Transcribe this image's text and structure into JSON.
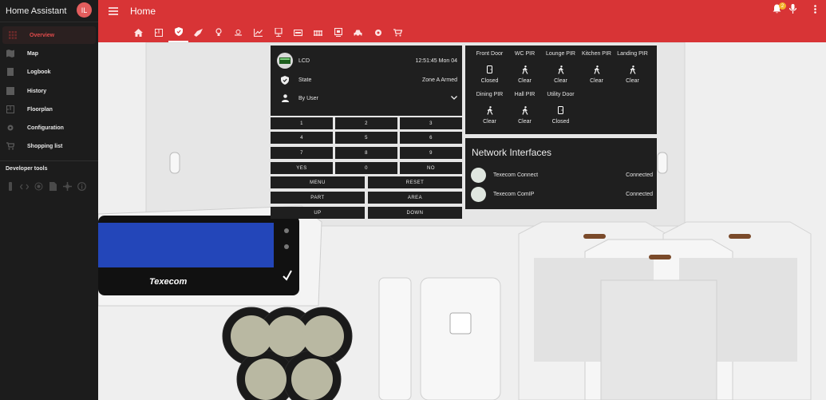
{
  "app": {
    "title": "Home Assistant",
    "avatar_initials": "IL"
  },
  "sidebar": {
    "items": [
      {
        "label": "Overview",
        "icon": "grid-icon",
        "active": true
      },
      {
        "label": "Map",
        "icon": "map-icon"
      },
      {
        "label": "Logbook",
        "icon": "logbook-icon"
      },
      {
        "label": "History",
        "icon": "history-icon"
      },
      {
        "label": "Floorplan",
        "icon": "floorplan-icon"
      },
      {
        "label": "Configuration",
        "icon": "gear-icon"
      },
      {
        "label": "Shopping list",
        "icon": "cart-icon"
      }
    ],
    "developer_tools_label": "Developer tools",
    "developer_icons": [
      "remote-icon",
      "code-icon",
      "antenna-icon",
      "file-icon",
      "network-icon",
      "info-icon"
    ]
  },
  "header": {
    "title": "Home",
    "tabs": [
      "home-icon",
      "floorplan-icon",
      "shield-icon",
      "rocket-icon",
      "bulb-icon",
      "weather-icon",
      "chart-icon",
      "monitor-icon",
      "tv-icon",
      "heater-icon",
      "media-icon",
      "car-icon",
      "gear-icon",
      "cart-icon"
    ],
    "notification_count": "2"
  },
  "alarm": {
    "lcd_label": "LCD",
    "lcd_value": "12:51:45 Mon 04",
    "state_label": "State",
    "state_value": "Zone A Armed",
    "user_label": "By User"
  },
  "keypad": {
    "keys": [
      "1",
      "2",
      "3",
      "4",
      "5",
      "6",
      "7",
      "8",
      "9",
      "YES",
      "0",
      "NO"
    ],
    "wide_keys": [
      "MENU",
      "RESET",
      "PART",
      "AREA",
      "UP",
      "DOWN"
    ]
  },
  "sensors": [
    {
      "name": "Front Door",
      "state": "Closed",
      "icon": "door-icon"
    },
    {
      "name": "WC PIR",
      "state": "Clear",
      "icon": "walk-icon"
    },
    {
      "name": "Lounge PIR",
      "state": "Clear",
      "icon": "walk-icon"
    },
    {
      "name": "Kitchen PIR",
      "state": "Clear",
      "icon": "walk-icon"
    },
    {
      "name": "Landing PIR",
      "state": "Clear",
      "icon": "walk-icon"
    },
    {
      "name": "Dining PIR",
      "state": "Clear",
      "icon": "walk-icon"
    },
    {
      "name": "Hall PIR",
      "state": "Clear",
      "icon": "walk-icon"
    },
    {
      "name": "Utility Door",
      "state": "Closed",
      "icon": "door-icon"
    }
  ],
  "network": {
    "title": "Network Interfaces",
    "items": [
      {
        "name": "Texecom Connect",
        "status": "Connected"
      },
      {
        "name": "Texecom ComIP",
        "status": "Connected"
      }
    ]
  },
  "background": {
    "brand_text": "Texecom"
  },
  "colors": {
    "accent": "#d83436",
    "sidebar": "#1c1c1c",
    "card": "#1f1f1f",
    "active_item": "#e04b4b",
    "badge": "#f3b12b"
  }
}
